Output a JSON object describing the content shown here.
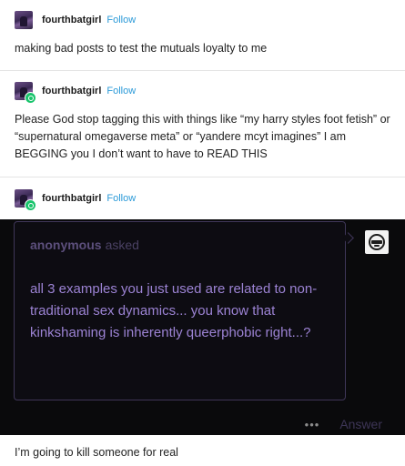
{
  "posts": [
    {
      "username": "fourthbatgirl",
      "follow_label": "Follow",
      "text": "making bad posts to test the mutuals loyalty to me"
    },
    {
      "username": "fourthbatgirl",
      "follow_label": "Follow",
      "text": "Please God stop tagging this with things like “my harry styles foot fetish” or “supernatural omegaverse meta” or “yandere mcyt imagines” I am BEGGING you I don’t want to have to READ THIS"
    },
    {
      "username": "fourthbatgirl",
      "follow_label": "Follow"
    }
  ],
  "ask": {
    "asker": "anonymous",
    "asked_word": "asked",
    "question": "all 3 examples you just used are related to non-traditional sex dynamics... you know that kinkshaming is inherently queerphobic right...?",
    "more_label": "•••",
    "answer_label": "Answer"
  },
  "reply": {
    "text": "I’m going to kill someone for real"
  },
  "colors": {
    "follow": "#2b9ad8",
    "ask_bg": "#0a0a0c",
    "question_text": "#9c83d4",
    "badge": "#19c46c"
  },
  "icons": {
    "avatar": "user-avatar-icon",
    "badge": "online-badge-icon",
    "anon": "anonymous-avatar-icon",
    "more": "more-options-icon"
  }
}
